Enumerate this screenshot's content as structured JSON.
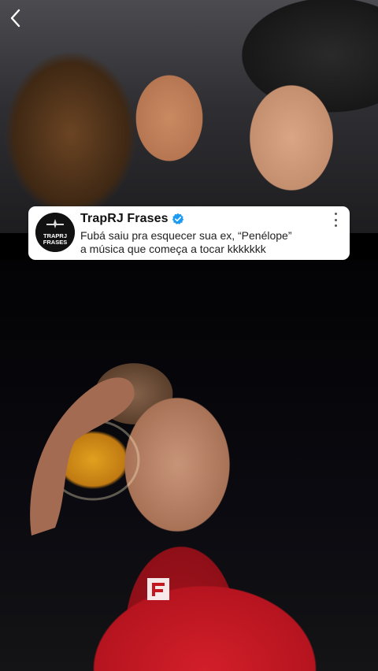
{
  "tweet": {
    "display_name": "TrapRJ Frases",
    "verified": true,
    "avatar_text_line1": "TRAPRJ",
    "avatar_text_line2": "FRASES",
    "text_line1": "Fubá saiu pra esquecer sua ex, “Penélope”",
    "text_line2": "a música que começa a tocar kkkkkkk"
  },
  "icons": {
    "back": "chevron-left-icon",
    "verified": "verified-badge-icon",
    "more": "more-vertical-icon"
  },
  "colors": {
    "verified_blue": "#1d9bf0",
    "card_bg": "#ffffff",
    "shirt_red": "#c4161f"
  }
}
